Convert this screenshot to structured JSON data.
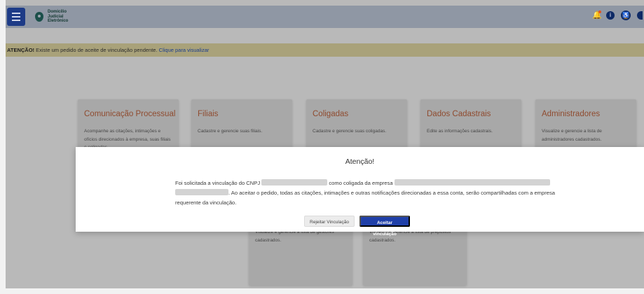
{
  "header": {
    "menu_icon": "hamburger-icon",
    "logo_lines": [
      "Domicílio",
      "Judicial",
      "Eletrônico"
    ],
    "icons": [
      "bell-icon",
      "info-icon",
      "accessibility-icon",
      "user-icon"
    ],
    "notification_dot_color": "#e1541f",
    "brand_color": "#1d3b87"
  },
  "alert": {
    "strong": "ATENÇÃO!",
    "text": " Existe um pedido de aceite de vinculação pendente. ",
    "link": "Clique para visualizar"
  },
  "cards": [
    {
      "title": "Comunicação Processual",
      "desc": "Acompanhe as citações, intimações e ofícios direcionados à empresa, suas filiais e coligadas."
    },
    {
      "title": "Filiais",
      "desc": "Cadastre e gerencie suas filiais."
    },
    {
      "title": "Coligadas",
      "desc": "Cadastre e gerencie suas coligadas."
    },
    {
      "title": "Dados Cadastrais",
      "desc": "Edite as informações cadastrais."
    },
    {
      "title": "Administradores",
      "desc": "Visualize e gerencie a lista de administradores cadastrados."
    },
    {
      "title": "",
      "desc": "Visualize e gerencie a lista de gestores cadastrados."
    },
    {
      "title": "",
      "desc": "Visualize e gerencie a lista de prepostos cadastrados."
    }
  ],
  "modal": {
    "title": "Atenção!",
    "body_part1": "Foi solicitada a vinculação do CNPJ ",
    "body_part2": " como coligada da empresa ",
    "body_part3": ". Ao aceitar o pedido, todas as citações, intimações e outras notificações direcionadas a essa conta, serão compartilhadas com a empresa requerente da vinculação.",
    "reject_label": "Rejeitar Vinculação",
    "accept_label": "Aceitar vinculação",
    "accept_color": "#1f3fa8"
  }
}
